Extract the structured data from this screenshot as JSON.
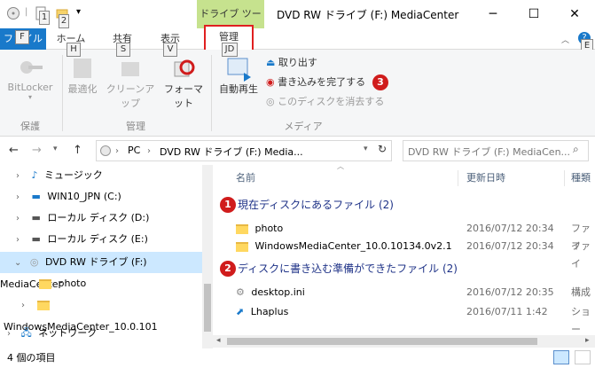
{
  "window": {
    "title": "DVD RW ドライブ (F:) MediaCenter",
    "context_group": "ドライブ ツール",
    "minimize": "─",
    "maximize": "☐",
    "close": "✕"
  },
  "keytips": {
    "qat1": "1",
    "qat2": "2",
    "file": "F",
    "home": "H",
    "share": "S",
    "view": "V",
    "manage": "JD",
    "help": "E"
  },
  "tabs": {
    "file": "ファイル",
    "home": "ホーム",
    "share": "共有",
    "view": "表示",
    "manage": "管理"
  },
  "ribbon": {
    "bitlocker": "BitLocker",
    "optimize": "最適化",
    "cleanup": "クリーンアップ",
    "format": "フォーマット",
    "autoplay": "自動再生",
    "eject": "取り出す",
    "finish_burning": "書き込みを完了する",
    "erase_disc": "このディスクを消去する",
    "group_protect": "保護",
    "group_manage": "管理",
    "group_media": "メディア"
  },
  "address": {
    "path": [
      "PC",
      "DVD RW ドライブ (F:) Media..."
    ],
    "search_placeholder": "DVD RW ドライブ (F:) MediaCen..."
  },
  "nav": {
    "items": [
      {
        "label": "ミュージック"
      },
      {
        "label": "WIN10_JPN (C:)"
      },
      {
        "label": "ローカル ディスク (D:)"
      },
      {
        "label": "ローカル ディスク (E:)"
      },
      {
        "label": "DVD RW ドライブ (F:) MediaCenter"
      },
      {
        "label": "photo"
      },
      {
        "label": "WindowsMediaCenter_10.0.101"
      },
      {
        "label": "ネットワーク"
      }
    ]
  },
  "columns": {
    "name": "名前",
    "date": "更新日時",
    "type": "種類"
  },
  "groups": [
    {
      "label": "現在ディスクにあるファイル (2)",
      "badge": "1",
      "files": [
        {
          "name": "photo",
          "date": "2016/07/12 20:34",
          "type": "ファイ"
        },
        {
          "name": "WindowsMediaCenter_10.0.10134.0v2.1",
          "date": "2016/07/12 20:34",
          "type": "ファイ"
        }
      ]
    },
    {
      "label": "ディスクに書き込む準備ができたファイル (2)",
      "badge": "2",
      "files": [
        {
          "name": "desktop.ini",
          "date": "2016/07/12 20:35",
          "type": "構成"
        },
        {
          "name": "Lhaplus",
          "date": "2016/07/11 1:42",
          "type": "ショー"
        }
      ]
    }
  ],
  "badge3": "3",
  "status": {
    "count": "4 個の項目"
  },
  "colors": {
    "file_tab": "#1979ca",
    "context": "#c6e28e",
    "highlight": "#e02020",
    "selection": "#cce8ff"
  }
}
